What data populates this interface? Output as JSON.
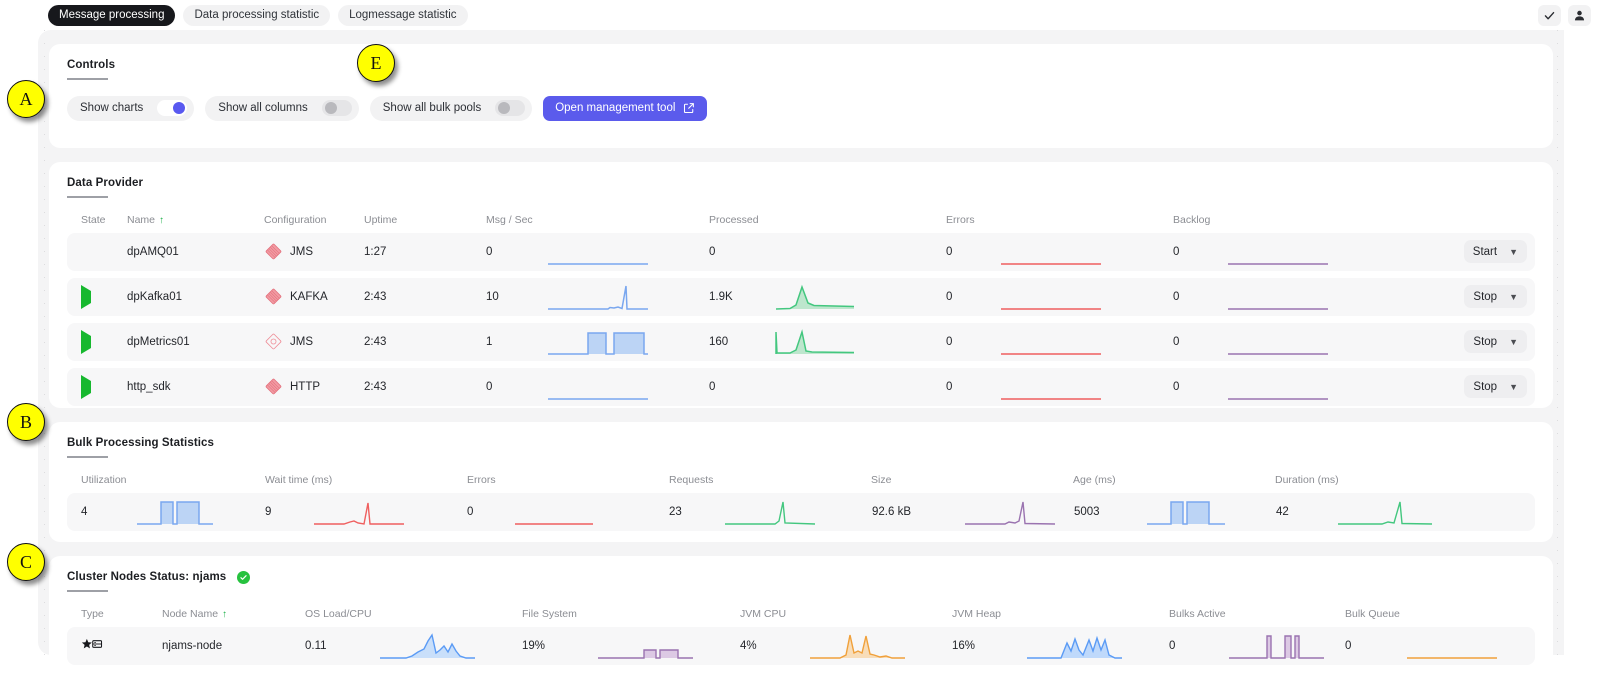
{
  "topbar": {
    "tabs": [
      {
        "label": "Message processing",
        "active": true
      },
      {
        "label": "Data processing statistic",
        "active": false
      },
      {
        "label": "Logmessage statistic",
        "active": false
      }
    ],
    "check_icon": "check-icon",
    "user_icon": "user-icon"
  },
  "controls": {
    "title": "Controls",
    "toggles": [
      {
        "label": "Show charts",
        "on": true
      },
      {
        "label": "Show all columns",
        "on": false
      },
      {
        "label": "Show all bulk pools",
        "on": false
      }
    ],
    "primary_button": {
      "label": "Open management tool",
      "icon": "external-link-icon",
      "color": "#5b5bec"
    }
  },
  "data_provider": {
    "title": "Data Provider",
    "columns": [
      "State",
      "Name",
      "Configuration",
      "Uptime",
      "Msg / Sec",
      "",
      "Processed",
      "",
      "Errors",
      "",
      "Backlog",
      ""
    ],
    "sorted_column": "Name",
    "rows": [
      {
        "state": "stopped",
        "name": "dpAMQ01",
        "config": "JMS",
        "config_icon": "diamond-stack-icon",
        "uptime": "1:27",
        "msg_sec": "0",
        "processed": "0",
        "errors": "0",
        "backlog": "0",
        "action": "Start"
      },
      {
        "state": "running",
        "name": "dpKafka01",
        "config": "KAFKA",
        "config_icon": "diamond-stack-icon",
        "uptime": "2:43",
        "msg_sec": "10",
        "processed": "1.9K",
        "errors": "0",
        "backlog": "0",
        "action": "Stop"
      },
      {
        "state": "running",
        "name": "dpMetrics01",
        "config": "JMS",
        "config_icon": "diamond-outline-icon",
        "uptime": "2:43",
        "msg_sec": "1",
        "processed": "160",
        "errors": "0",
        "backlog": "0",
        "action": "Stop"
      },
      {
        "state": "running",
        "name": "http_sdk",
        "config": "HTTP",
        "config_icon": "diamond-stack-icon",
        "uptime": "2:43",
        "msg_sec": "0",
        "processed": "0",
        "errors": "0",
        "backlog": "0",
        "action": "Stop"
      }
    ]
  },
  "bulk": {
    "title": "Bulk Processing Statistics",
    "columns": [
      "Utilization",
      "Wait time (ms)",
      "Errors",
      "Requests",
      "Size",
      "Age (ms)",
      "Duration (ms)"
    ],
    "values": [
      "4",
      "9",
      "0",
      "23",
      "92.6 kB",
      "5003",
      "42"
    ]
  },
  "cluster": {
    "title": "Cluster Nodes Status:",
    "cluster_name": "njams",
    "status_icon": "check-circle-icon",
    "columns": [
      "Type",
      "Node Name",
      "OS Load/CPU",
      "File System",
      "JVM CPU",
      "JVM Heap",
      "Bulks Active",
      "Bulk Queue"
    ],
    "sorted_column": "Node Name",
    "rows": [
      {
        "type_icon": "star-server-icon",
        "node_name": "njams-node",
        "os_load": "0.11",
        "file_system": "19%",
        "jvm_cpu": "4%",
        "jvm_heap": "16%",
        "bulks_active": "0",
        "bulk_queue": "0"
      }
    ]
  },
  "markers": [
    {
      "id": "A",
      "label": "A"
    },
    {
      "id": "B",
      "label": "B"
    },
    {
      "id": "C",
      "label": "C"
    },
    {
      "id": "E",
      "label": "E"
    }
  ],
  "colors": {
    "accent": "#5b5bec",
    "running": "#17b82f",
    "stopped": "#e2213a",
    "marker": "#ffff00",
    "spark_blue": "#7aa7ef",
    "spark_green": "#43c77f",
    "spark_red": "#ef5f5f",
    "spark_purple": "#9a73b0",
    "spark_orange": "#f0a03a"
  },
  "chart_data": [
    {
      "type": "area",
      "name": "dpAMQ01 Msg/Sec",
      "color": "#7aa7ef",
      "y": [
        0,
        0,
        0,
        0,
        0,
        0,
        0,
        0,
        0,
        0,
        0,
        0,
        0,
        0,
        0,
        0,
        0,
        0,
        0,
        0
      ],
      "ylim": [
        0,
        1
      ]
    },
    {
      "type": "area",
      "name": "dpKafka01 Msg/Sec",
      "color": "#7aa7ef",
      "y": [
        0,
        0,
        0,
        0,
        0,
        0,
        0,
        0,
        0,
        0,
        0,
        0,
        0.04,
        0.04,
        0.06,
        0.05,
        1,
        0.02,
        0,
        0
      ],
      "ylim": [
        0,
        1
      ]
    },
    {
      "type": "area",
      "name": "dpMetrics01 Msg/Sec",
      "color": "#7aa7ef",
      "y": [
        0,
        0,
        0,
        0,
        0,
        0,
        0,
        0,
        0,
        0,
        0,
        1,
        1,
        1,
        1,
        0,
        1,
        1,
        1,
        1
      ],
      "ylim": [
        0,
        1
      ]
    },
    {
      "type": "area",
      "name": "http_sdk Msg/Sec",
      "color": "#7aa7ef",
      "y": [
        0,
        0,
        0,
        0,
        0,
        0,
        0,
        0,
        0,
        0,
        0,
        0,
        0,
        0,
        0,
        0,
        0,
        0,
        0,
        0
      ],
      "ylim": [
        0,
        1
      ]
    },
    {
      "type": "area",
      "name": "dpAMQ01 Processed",
      "color": "#43c77f",
      "y": [
        0,
        0,
        0,
        0,
        0,
        0,
        0,
        0,
        0,
        0,
        0,
        0,
        0,
        0,
        0,
        0,
        0,
        0,
        0,
        0
      ],
      "ylim": [
        0,
        1
      ]
    },
    {
      "type": "area",
      "name": "dpKafka01 Processed",
      "color": "#43c77f",
      "y": [
        0,
        0,
        0,
        0,
        0.05,
        0.1,
        0.9,
        0.35,
        0.12,
        0.1,
        0.09,
        0.08,
        0.08,
        0.07,
        0.07,
        0,
        0,
        0,
        0,
        0
      ],
      "ylim": [
        0,
        1
      ]
    },
    {
      "type": "area",
      "name": "dpMetrics01 Processed",
      "color": "#43c77f",
      "y": [
        0,
        0,
        0,
        0.85,
        0.02,
        0.02,
        0.03,
        0.95,
        0.25,
        0.05,
        0.04,
        0.03,
        0.03,
        0.03,
        0.02,
        0,
        0,
        0,
        0,
        0
      ],
      "ylim": [
        0,
        1
      ]
    },
    {
      "type": "area",
      "name": "http_sdk Processed",
      "color": "#43c77f",
      "y": [
        0,
        0,
        0,
        0,
        0,
        0,
        0,
        0,
        0,
        0,
        0,
        0,
        0,
        0,
        0,
        0,
        0,
        0,
        0,
        0
      ],
      "ylim": [
        0,
        1
      ]
    },
    {
      "type": "area",
      "name": "Errors (all rows)",
      "color": "#ef5f5f",
      "y": [
        0,
        0,
        0,
        0,
        0,
        0,
        0,
        0,
        0,
        0,
        0,
        0,
        0,
        0,
        0,
        0,
        0,
        0,
        0,
        0
      ],
      "ylim": [
        0,
        1
      ]
    },
    {
      "type": "area",
      "name": "Backlog (all rows)",
      "color": "#9a73b0",
      "y": [
        0,
        0,
        0,
        0,
        0,
        0,
        0,
        0,
        0,
        0,
        0,
        0,
        0,
        0,
        0,
        0,
        0,
        0,
        0,
        0
      ],
      "ylim": [
        0,
        1
      ]
    },
    {
      "type": "area",
      "name": "Bulk Utilization",
      "color": "#7aa7ef",
      "y": [
        0,
        0,
        0,
        0,
        0,
        0,
        0,
        0,
        1,
        1,
        1,
        1,
        0,
        1,
        1,
        1,
        1,
        1,
        0,
        0
      ],
      "ylim": [
        0,
        1
      ],
      "value": 4
    },
    {
      "type": "area",
      "name": "Bulk Wait time (ms)",
      "color": "#ef5f5f",
      "y": [
        0,
        0,
        0,
        0,
        0,
        0,
        0,
        0,
        0,
        0.1,
        0.18,
        0.1,
        0.08,
        1,
        0.1,
        0.03,
        0,
        0,
        0,
        0
      ],
      "ylim": [
        0,
        1
      ],
      "value": 9
    },
    {
      "type": "area",
      "name": "Bulk Errors",
      "color": "#ef5f5f",
      "y": [
        0,
        0,
        0,
        0,
        0,
        0,
        0,
        0,
        0,
        0,
        0,
        0,
        0,
        0,
        0,
        0,
        0,
        0,
        0,
        0
      ],
      "ylim": [
        0,
        1
      ],
      "value": 0
    },
    {
      "type": "area",
      "name": "Bulk Requests",
      "color": "#43c77f",
      "y": [
        0,
        0,
        0,
        0,
        0,
        0,
        0,
        0,
        0,
        0,
        0,
        0,
        0,
        0.08,
        0.9,
        0.05,
        0,
        0,
        0,
        0
      ],
      "ylim": [
        0,
        1
      ],
      "value": 23
    },
    {
      "type": "area",
      "name": "Bulk Size",
      "color": "#9a73b0",
      "y": [
        0,
        0,
        0,
        0,
        0,
        0,
        0,
        0,
        0.05,
        0.06,
        0.05,
        0.05,
        0.08,
        0.9,
        0.05,
        0.03,
        0,
        0,
        0,
        0
      ],
      "ylim": [
        0,
        1
      ],
      "value": "92.6 kB"
    },
    {
      "type": "area",
      "name": "Bulk Age (ms)",
      "color": "#7aa7ef",
      "y": [
        0,
        0,
        0,
        0,
        0,
        0,
        0,
        0,
        0,
        1,
        1,
        1,
        1,
        0,
        1,
        1,
        1,
        1,
        0,
        0
      ],
      "ylim": [
        0,
        1
      ],
      "value": 5003
    },
    {
      "type": "area",
      "name": "Bulk Duration (ms)",
      "color": "#43c77f",
      "y": [
        0,
        0,
        0,
        0,
        0,
        0,
        0,
        0,
        0,
        0,
        0,
        0,
        0.15,
        0.1,
        0.05,
        0.95,
        0.05,
        0,
        0,
        0
      ],
      "ylim": [
        0,
        1
      ],
      "value": 42
    },
    {
      "type": "area",
      "name": "OS Load/CPU",
      "color": "#5b9bf5",
      "y": [
        0,
        0,
        0,
        0,
        0,
        0,
        0.05,
        0.1,
        0.3,
        0.25,
        0.5,
        1,
        0.2,
        0.15,
        0.35,
        0.3,
        0.4,
        0.2,
        0.05,
        0
      ],
      "ylim": [
        0,
        1
      ],
      "value": 0.11
    },
    {
      "type": "area",
      "name": "File System",
      "color": "#9a73b0",
      "y": [
        0,
        0,
        0,
        0,
        0,
        0,
        0,
        0,
        0,
        0,
        0.45,
        0.45,
        0.45,
        0.2,
        0.45,
        0.45,
        0.45,
        0,
        0,
        0
      ],
      "ylim": [
        0,
        1
      ],
      "value": "19%"
    },
    {
      "type": "area",
      "name": "JVM CPU",
      "color": "#f0a03a",
      "y": [
        0,
        0,
        0,
        0,
        0,
        0,
        0,
        0.1,
        1,
        0.35,
        0.15,
        0.95,
        0.2,
        0.3,
        0.2,
        0.12,
        0.08,
        0,
        0,
        0
      ],
      "ylim": [
        0,
        1
      ],
      "value": "4%"
    },
    {
      "type": "area",
      "name": "JVM Heap",
      "color": "#5b9bf5",
      "y": [
        0,
        0,
        0,
        0,
        0,
        0,
        0,
        0,
        0.6,
        0.25,
        0.75,
        0.3,
        0.1,
        0.8,
        0.3,
        0.85,
        0.35,
        0.8,
        0.1,
        0
      ],
      "ylim": [
        0,
        1
      ],
      "value": "16%"
    },
    {
      "type": "area",
      "name": "Bulks Active",
      "color": "#9a73b0",
      "y": [
        0,
        0,
        0,
        0,
        0,
        0,
        0,
        0,
        0,
        0.95,
        0,
        0,
        0.95,
        0.95,
        0.1,
        1,
        0,
        0,
        0,
        0
      ],
      "ylim": [
        0,
        1
      ],
      "value": 0
    },
    {
      "type": "area",
      "name": "Bulk Queue",
      "color": "#f0a03a",
      "y": [
        0,
        0,
        0,
        0,
        0,
        0,
        0,
        0,
        0,
        0,
        0,
        0,
        0,
        0,
        0,
        0,
        0,
        0,
        0,
        0
      ],
      "ylim": [
        0,
        1
      ],
      "value": 0
    }
  ]
}
